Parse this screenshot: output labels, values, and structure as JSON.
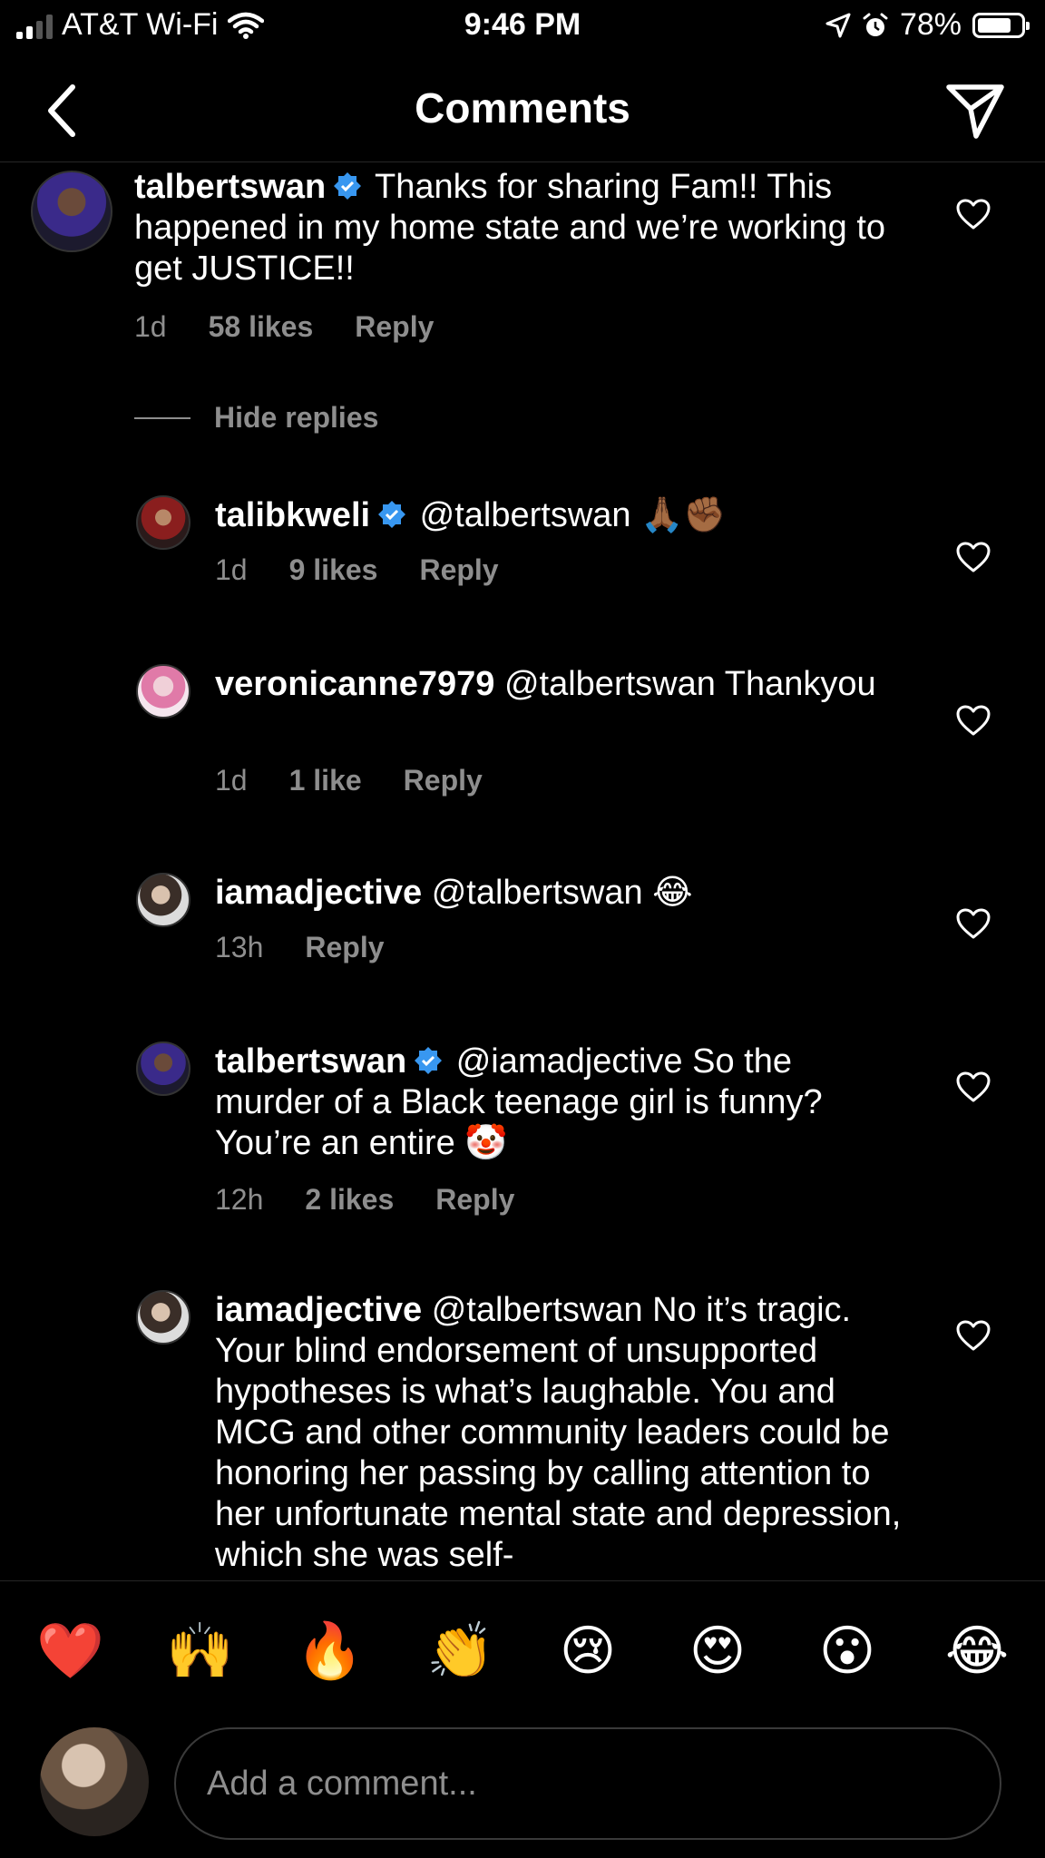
{
  "status_bar": {
    "carrier": "AT&T Wi-Fi",
    "time": "9:46 PM",
    "battery": "78%",
    "battery_level": 0.78
  },
  "header": {
    "title": "Comments"
  },
  "comments": [
    {
      "username": "talbertswan",
      "verified": true,
      "mention": "",
      "text": "Thanks for sharing Fam!! This happened in my home state and we’re working to get JUSTICE!!",
      "time": "1d",
      "likes": "58 likes",
      "reply": "Reply"
    }
  ],
  "hide_replies": "Hide replies",
  "replies": [
    {
      "username": "talibkweli",
      "verified": true,
      "mention": "@talbertswan",
      "text": "🙏🏾✊🏾",
      "time": "1d",
      "likes": "9 likes",
      "reply": "Reply"
    },
    {
      "username": "veronicanne7979",
      "verified": false,
      "mention": "@talbertswan",
      "text": "Thankyou",
      "time": "1d",
      "likes": "1 like",
      "reply": "Reply"
    },
    {
      "username": "iamadjective",
      "verified": false,
      "mention": "@talbertswan",
      "text": "😂",
      "time": "13h",
      "likes": "",
      "reply": "Reply"
    },
    {
      "username": "talbertswan",
      "verified": true,
      "mention": "@iamadjective",
      "text": "So the murder of a Black teenage girl is funny? You’re an entire 🤡",
      "time": "12h",
      "likes": "2 likes",
      "reply": "Reply"
    },
    {
      "username": "iamadjective",
      "verified": false,
      "mention": "@talbertswan",
      "text": "No it’s tragic. Your blind endorsement of unsupported hypotheses is what’s laughable. You and MCG and other community leaders could be honoring her passing by calling attention to her unfortunate mental state and depression, which she was self-",
      "time": "",
      "likes": "",
      "reply": ""
    }
  ],
  "reactions": [
    "❤️",
    "🙌",
    "🔥",
    "👏",
    "😢",
    "😍",
    "😮",
    "😂"
  ],
  "composer": {
    "placeholder": "Add a comment..."
  },
  "colors": {
    "background": "#000000",
    "secondary_text": "#8e8e8e",
    "verified": "#3897f0"
  }
}
